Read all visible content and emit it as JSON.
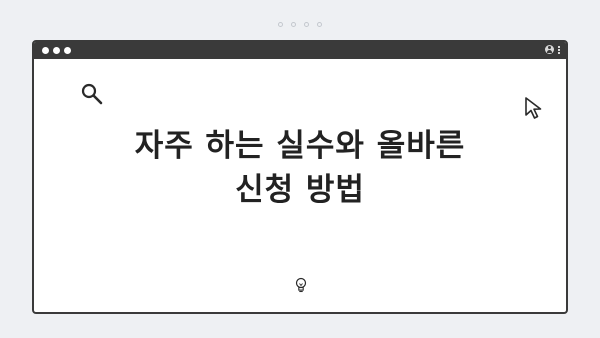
{
  "pager": {
    "count": 4
  },
  "window": {
    "titlebar": {
      "controls": [
        "dot",
        "dot",
        "dot"
      ],
      "right_icons": [
        "user-icon",
        "more-vertical-icon"
      ]
    }
  },
  "content": {
    "headline_line1": "자주 하는 실수와 올바른",
    "headline_line2": "신청 방법",
    "decorations": [
      "search-icon",
      "cursor-icon",
      "lightbulb-icon"
    ]
  },
  "colors": {
    "page_background": "#eef0f3",
    "window_frame": "#3a3a3a",
    "window_body": "#ffffff",
    "headline_text": "#222222"
  }
}
